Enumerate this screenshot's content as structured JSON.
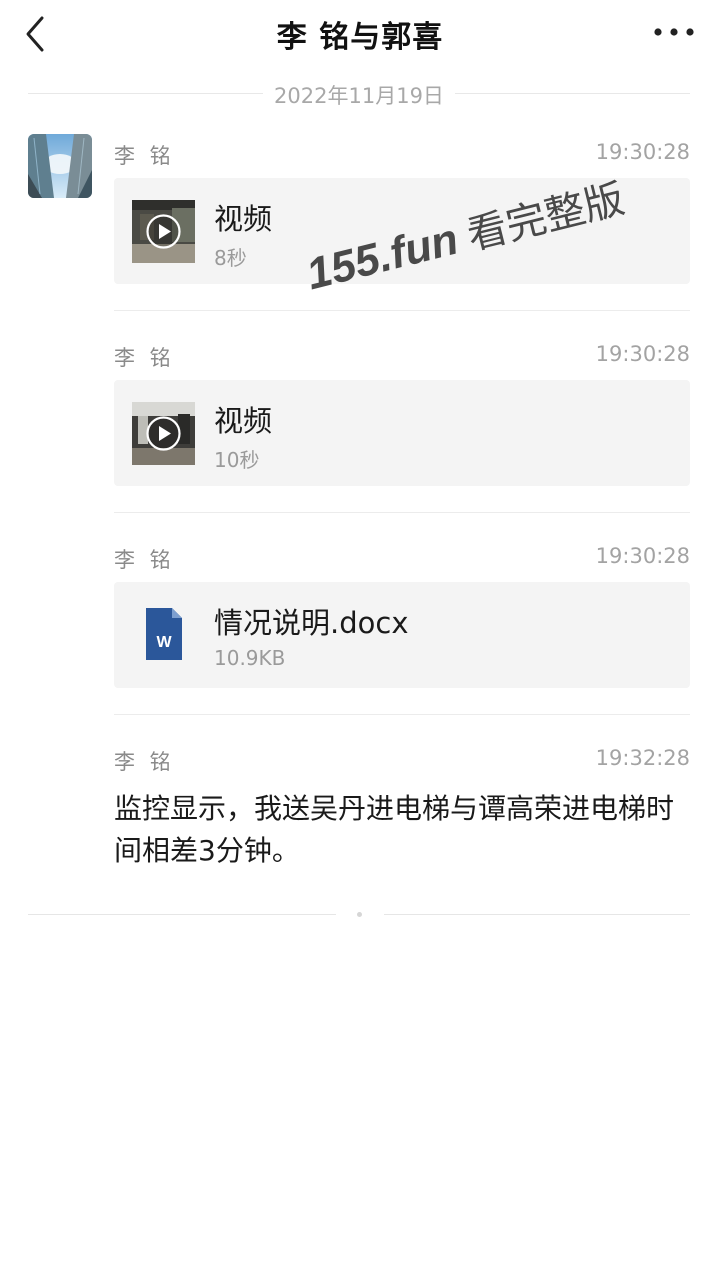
{
  "header": {
    "title": "李 铭与郭喜",
    "back_icon": "chevron-left-icon",
    "more_icon": "more-horizontal-icon"
  },
  "date_divider": "2022年11月19日",
  "messages": [
    {
      "sender": "李 铭",
      "time": "19:30:28",
      "type": "video",
      "name": "视频",
      "meta": "8秒"
    },
    {
      "sender": "李 铭",
      "time": "19:30:28",
      "type": "video",
      "name": "视频",
      "meta": "10秒"
    },
    {
      "sender": "李 铭",
      "time": "19:30:28",
      "type": "file",
      "name": "情况说明.docx",
      "meta": "10.9KB",
      "icon": "word-file-icon",
      "icon_letter": "W",
      "icon_color": "#2b579a"
    },
    {
      "sender": "李 铭",
      "time": "19:32:28",
      "type": "text",
      "text": "监控显示，我送吴丹进电梯与谭高荣进电梯时间相差3分钟。"
    }
  ],
  "watermark": {
    "url": "155.fun",
    "text": "看完整版"
  }
}
